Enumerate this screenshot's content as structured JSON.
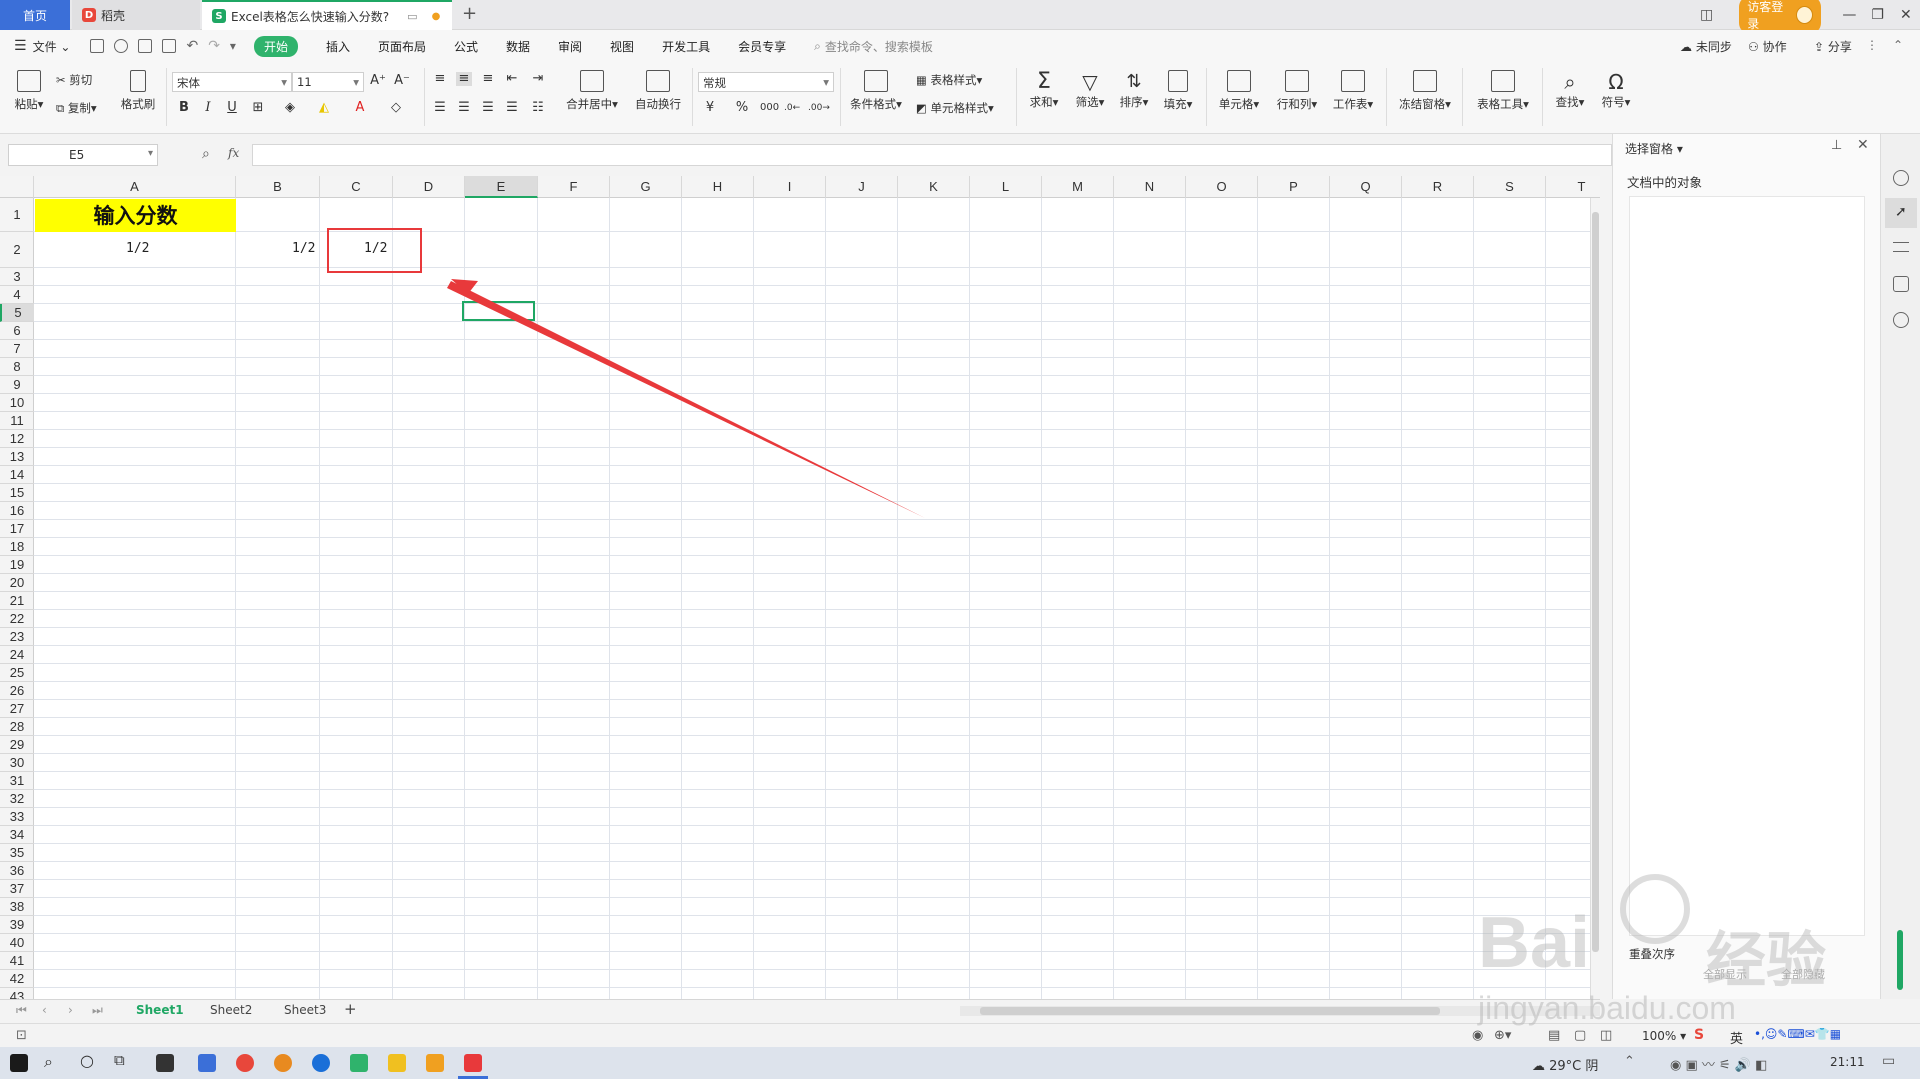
{
  "tabs": {
    "home": "首页",
    "daoke": "稻壳",
    "doc": "Excel表格怎么快速输入分数?"
  },
  "titlebar": {
    "guest_login": "访客登录"
  },
  "menu": {
    "file": "文件",
    "items": [
      "开始",
      "插入",
      "页面布局",
      "公式",
      "数据",
      "审阅",
      "视图",
      "开发工具",
      "会员专享"
    ],
    "search_placeholder": "查找命令、搜索模板",
    "unsynced": "未同步",
    "collab": "协作",
    "share": "分享"
  },
  "ribbon": {
    "paste": "粘贴",
    "cut": "剪切",
    "copy": "复制",
    "format_painter": "格式刷",
    "font_name": "宋体",
    "font_size": "11",
    "merge_center": "合并居中",
    "auto_wrap": "自动换行",
    "number_format": "常规",
    "conditional_format": "条件格式",
    "table_style": "表格样式",
    "cell_style": "单元格样式",
    "sum": "求和",
    "filter": "筛选",
    "sort": "排序",
    "fill": "填充",
    "cells": "单元格",
    "rows_cols": "行和列",
    "worksheet": "工作表",
    "freeze_panes": "冻结窗格",
    "table_tools": "表格工具",
    "find": "查找",
    "symbol": "符号"
  },
  "formula": {
    "name_box": "E5",
    "fx": "fx"
  },
  "grid": {
    "columns": [
      "A",
      "B",
      "C",
      "D",
      "E",
      "F",
      "G",
      "H",
      "I",
      "J",
      "K",
      "L",
      "M",
      "N",
      "O",
      "P",
      "Q",
      "R",
      "S",
      "T"
    ],
    "selected_column": "E",
    "selected_row": "5",
    "rows": [
      "1",
      "2",
      "3",
      "4",
      "5",
      "6",
      "7",
      "8",
      "9",
      "10",
      "11",
      "12",
      "13",
      "14",
      "15",
      "16",
      "17",
      "18",
      "19",
      "20",
      "21",
      "22",
      "23",
      "24",
      "25",
      "26",
      "27",
      "28",
      "29",
      "30",
      "31",
      "32",
      "33",
      "34",
      "35",
      "36",
      "37",
      "38",
      "39",
      "40",
      "41",
      "42",
      "43"
    ],
    "cells": {
      "A1": "输入分数",
      "A2": "1/2",
      "B2": "1/2",
      "C2": "1/2"
    }
  },
  "panel": {
    "title": "选择窗格",
    "objects_label": "文档中的对象",
    "show_all": "全部显示",
    "hide_all": "全部隐藏",
    "reorder": "重叠次序"
  },
  "sheets": [
    "Sheet1",
    "Sheet2",
    "Sheet3"
  ],
  "active_sheet": "Sheet1",
  "status": {
    "zoom": "100%"
  },
  "taskbar": {
    "weather": "29°C 阴",
    "time": "21:11",
    "ime_lang": "英"
  },
  "watermark": {
    "brand": "Bai",
    "brand2": "经验",
    "url": "jingyan.baidu.com"
  },
  "colors": {
    "accent_green": "#1fa764",
    "highlight_yellow": "#ffff00",
    "annotation_red": "#e8393b",
    "home_tab_blue": "#3b6fd8"
  }
}
